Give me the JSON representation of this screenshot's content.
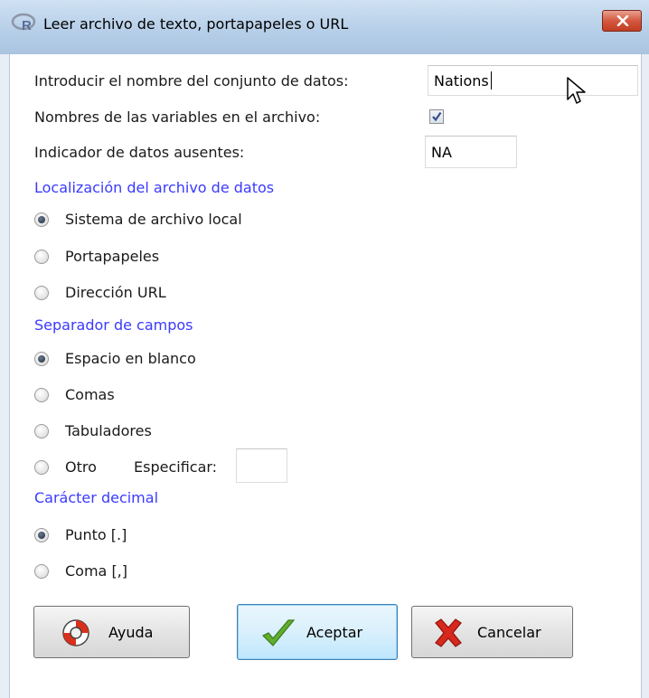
{
  "window": {
    "title": "Leer archivo de texto, portapapeles o URL",
    "close_icon": "close-icon"
  },
  "form": {
    "dataset_name_label": "Introducir el nombre del conjunto de datos:",
    "dataset_name_value": "Nations",
    "var_names_label": "Nombres de las variables en el archivo:",
    "var_names_checked": true,
    "missing_label": "Indicador de datos ausentes:",
    "missing_value": "NA"
  },
  "location": {
    "heading": "Localización del archivo de datos",
    "options": [
      {
        "label": "Sistema de archivo local",
        "selected": true
      },
      {
        "label": "Portapapeles",
        "selected": false
      },
      {
        "label": "Dirección URL",
        "selected": false
      }
    ]
  },
  "separator": {
    "heading": "Separador de campos",
    "options": [
      {
        "label": "Espacio en blanco",
        "selected": true
      },
      {
        "label": "Comas",
        "selected": false
      },
      {
        "label": "Tabuladores",
        "selected": false
      },
      {
        "label": "Otro",
        "selected": false
      }
    ],
    "specify_label": "Especificar:",
    "specify_value": ""
  },
  "decimal": {
    "heading": "Carácter decimal",
    "options": [
      {
        "label": "Punto [.]",
        "selected": true
      },
      {
        "label": "Coma [,]",
        "selected": false
      }
    ]
  },
  "buttons": {
    "help": "Ayuda",
    "ok": "Aceptar",
    "cancel": "Cancelar"
  },
  "colors": {
    "section_heading": "#3a3aff",
    "titlebar": "#b7cfe8",
    "close_button": "#c23d24"
  }
}
